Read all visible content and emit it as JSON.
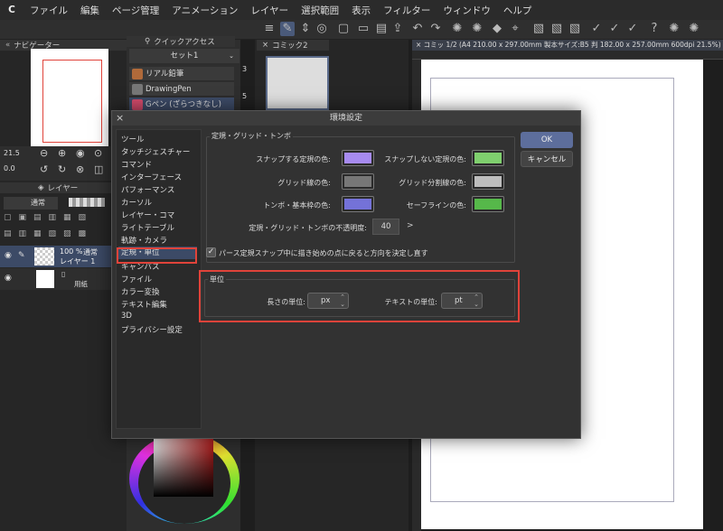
{
  "menubar": {
    "logo": "C",
    "items": [
      "ファイル",
      "編集",
      "ページ管理",
      "アニメーション",
      "レイヤー",
      "選択範囲",
      "表示",
      "フィルター",
      "ウィンドウ",
      "ヘルプ"
    ]
  },
  "navigator": {
    "title": "ナビゲーター",
    "zoom": "21.5",
    "angle": "0.0"
  },
  "quick_access": {
    "title": "クイックアクセス",
    "set": "セット1",
    "items": [
      {
        "label": "リアル鉛筆"
      },
      {
        "label": "DrawingPen"
      },
      {
        "label": "Gペン (ざらつきなし)"
      }
    ],
    "side_numbers": [
      "3",
      "5"
    ]
  },
  "layers": {
    "title": "レイヤー",
    "blend": "通常",
    "items": [
      {
        "opacity": "100 %",
        "mode": "通常",
        "name": "レイヤー 1"
      },
      {
        "name": "用紙"
      }
    ]
  },
  "page_panel": {
    "tab": "コミック2"
  },
  "document": {
    "tab": "コミッ 1/2 (A4 210.00 x 297.00mm 製本サイズ:B5 判 182.00 x 257.00mm 600dpi 21.5%)"
  },
  "dialog": {
    "title": "環境設定",
    "categories": [
      "ツール",
      "タッチジェスチャー",
      "コマンド",
      "インターフェース",
      "パフォーマンス",
      "カーソル",
      "レイヤー・コマ",
      "ライトテーブル",
      "軌跡・カメラ",
      "定規・単位",
      "キャンバス",
      "ファイル",
      "カラー変換",
      "テキスト編集",
      "3D",
      "プライバシー設定"
    ],
    "selected_index": 9,
    "guides_group": {
      "title": "定規・グリッド・トンボ",
      "rows": [
        {
          "left_label": "スナップする定規の色:",
          "left_color": "#a78bf0",
          "right_label": "スナップしない定規の色:",
          "right_color": "#7fcf6e"
        },
        {
          "left_label": "グリッド線の色:",
          "left_color": "#777777",
          "right_label": "グリッド分割線の色:",
          "right_color": "#bdbdbd"
        },
        {
          "left_label": "トンボ・基本枠の色:",
          "left_color": "#7472d8",
          "right_label": "セーフラインの色:",
          "right_color": "#56b84a"
        }
      ],
      "opacity_label": "定規・グリッド・トンボの不透明度:",
      "opacity_value": "40",
      "opacity_arrow": ">",
      "checkbox_label": "パース定規スナップ中に描き始めの点に戻ると方向を決定し直す",
      "checkbox_mark": "✓"
    },
    "units_group": {
      "title": "単位",
      "length_label": "長さの単位:",
      "length_value": "px",
      "text_label": "テキストの単位:",
      "text_value": "pt"
    },
    "ok": "OK",
    "cancel": "キャンセル",
    "close": "×"
  },
  "colors": {
    "accent_red": "#e0433a",
    "ok_button": "#5d6e9c",
    "selection": "#3c4a66"
  }
}
